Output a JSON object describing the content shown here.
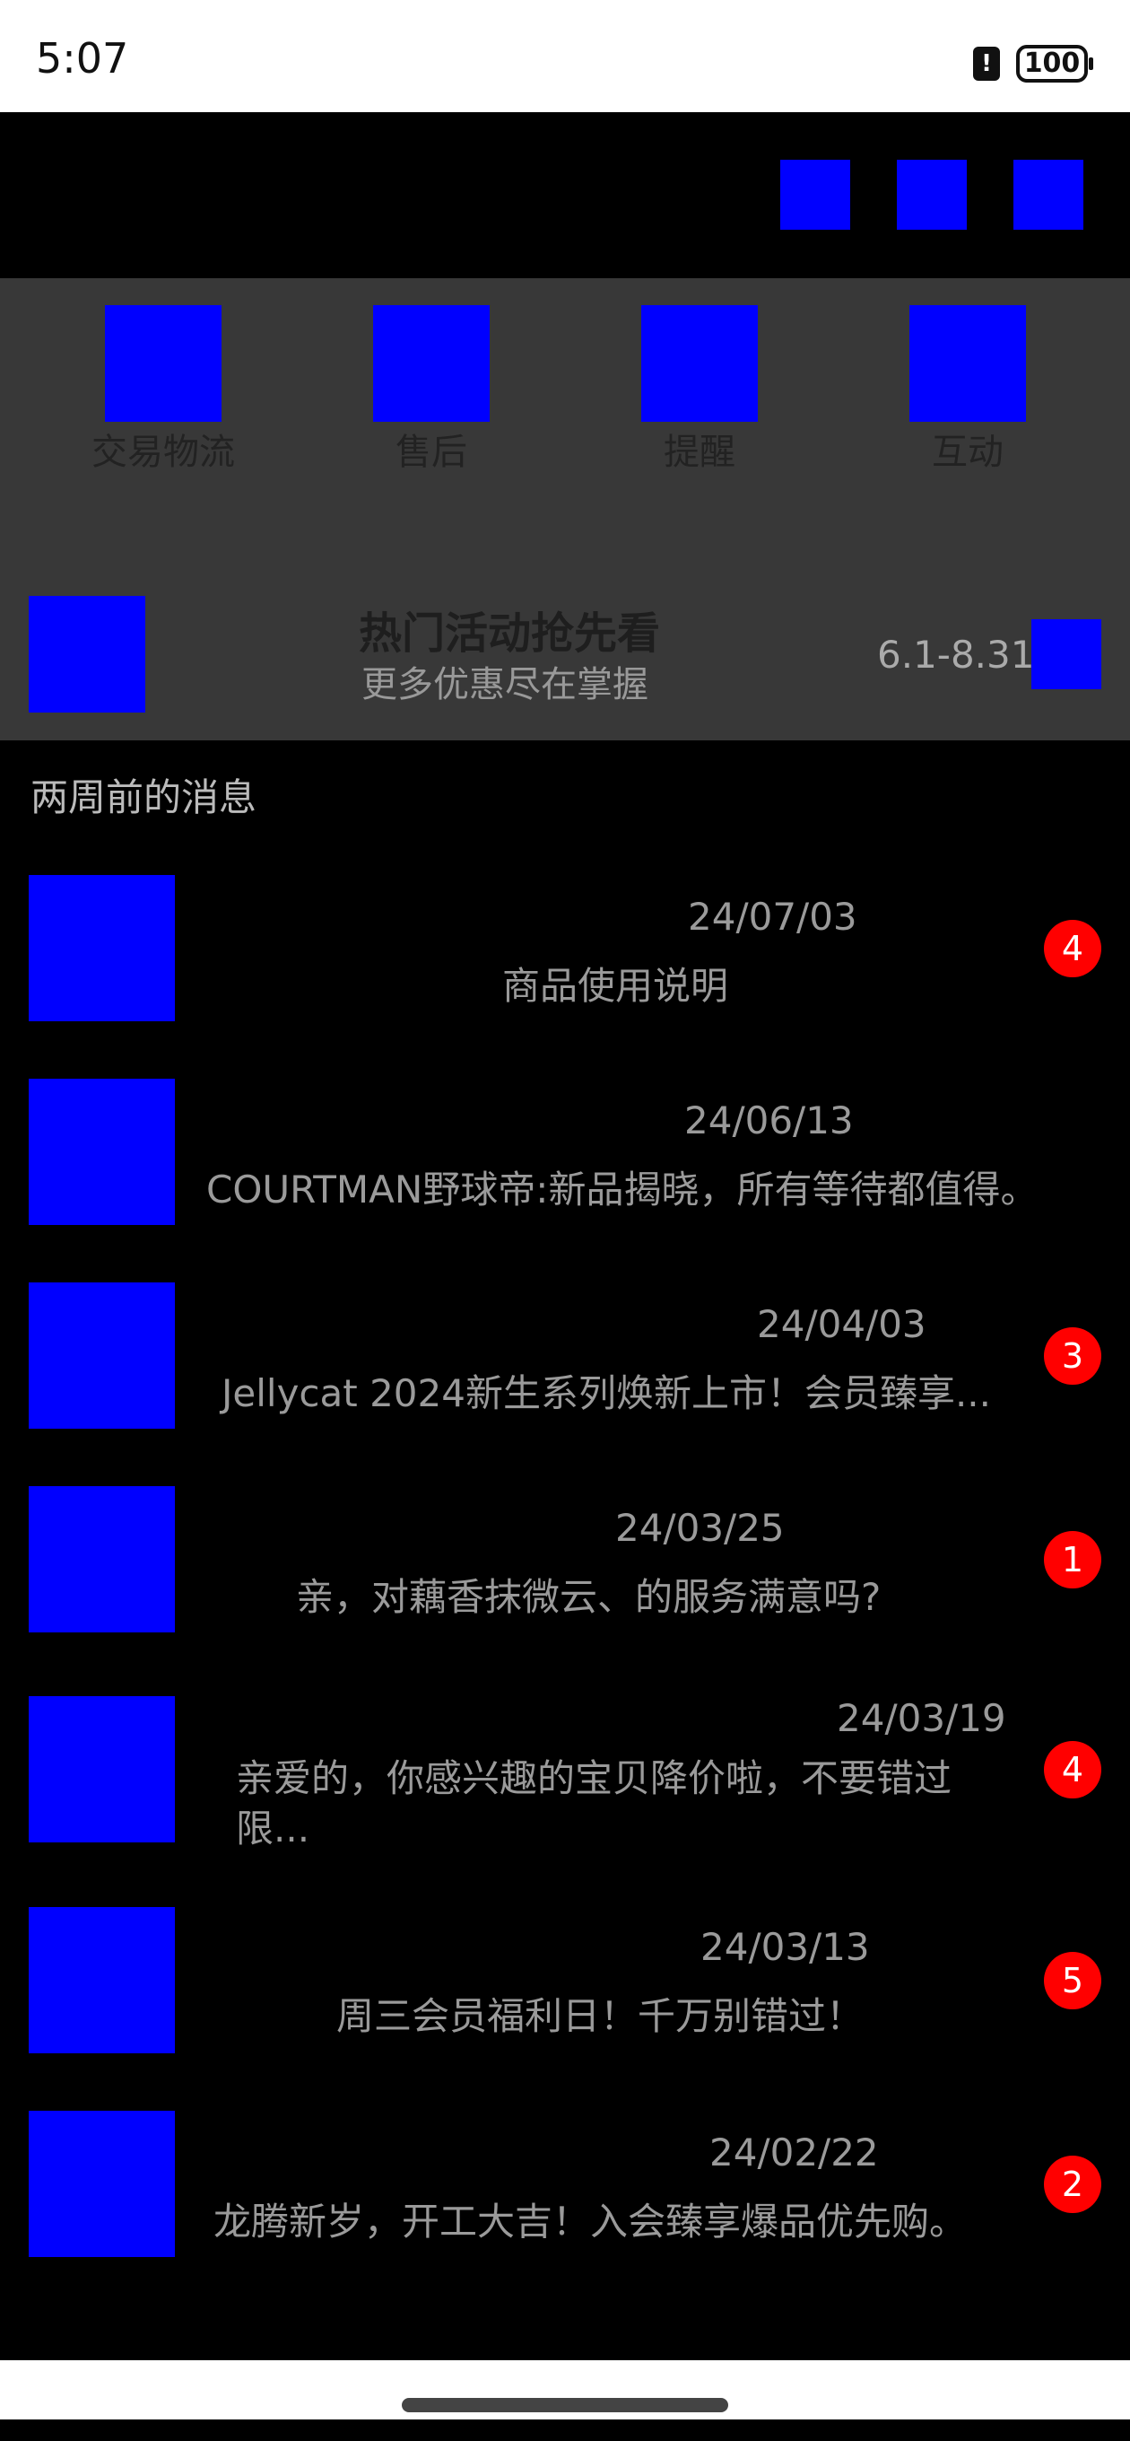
{
  "status_bar": {
    "time": "5:07",
    "alert_icon": "!",
    "battery": "100"
  },
  "header": {
    "icons": [
      "header-icon-1",
      "header-icon-2",
      "header-icon-3"
    ]
  },
  "categories": [
    {
      "label": "交易物流",
      "icon": "logistics-icon"
    },
    {
      "label": "售后",
      "icon": "after-sales-icon"
    },
    {
      "label": "提醒",
      "icon": "reminder-icon"
    },
    {
      "label": "互动",
      "icon": "interaction-icon"
    }
  ],
  "promo": {
    "title": "热门活动抢先看",
    "subtitle": "更多优惠尽在掌握",
    "date_range": "6.1-8.31"
  },
  "section": {
    "title": "两周前的消息"
  },
  "messages": [
    {
      "date": "24/07/03",
      "text": "商品使用说明",
      "badge": "4"
    },
    {
      "date": "24/06/13",
      "text": "COURTMAN野球帝:新品揭晓，所有等待都值得。",
      "badge": ""
    },
    {
      "date": "24/04/03",
      "text": "Jellycat 2024新生系列焕新上市！会员臻享...",
      "badge": "3"
    },
    {
      "date": "24/03/25",
      "text": "亲，对藕香抹微云、的服务满意吗?",
      "badge": "1"
    },
    {
      "date": "24/03/19",
      "text": "亲爱的，你感兴趣的宝贝降价啦，不要错过限...",
      "badge": "4"
    },
    {
      "date": "24/03/13",
      "text": "周三会员福利日！千万别错过！",
      "badge": "5"
    },
    {
      "date": "24/02/22",
      "text": "龙腾新岁，开工大吉！入会臻享爆品优先购。",
      "badge": "2"
    }
  ],
  "colors": {
    "placeholder": "#0000ff",
    "badge": "#ff0000",
    "panel": "#383838"
  }
}
